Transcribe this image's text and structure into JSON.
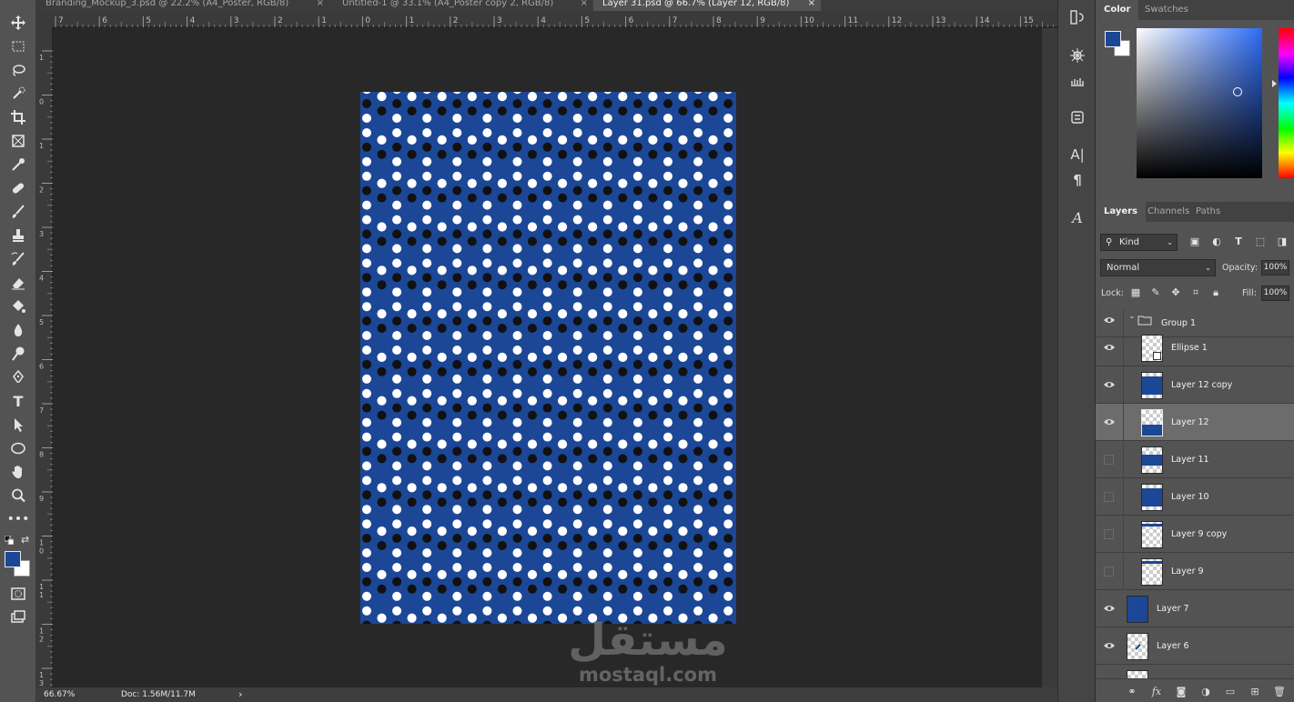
{
  "tabs": [
    {
      "label": "Branding_Mockup_3.psd @ 22.2% (A4_Poster, RGB/8)",
      "close": "×"
    },
    {
      "label": "Untitled-1 @ 33.1% (A4_Poster copy 2, RGB/8)",
      "close": "×"
    },
    {
      "label": "Layer 31.psd @ 66.7% (Layer 12, RGB/8)",
      "close": "×"
    }
  ],
  "tools": [
    "move-tool-icon",
    "marquee-tool-icon",
    "lasso-tool-icon",
    "quick-selection-tool-icon",
    "crop-tool-icon",
    "frame-tool-icon",
    "eyedropper-tool-icon",
    "healing-brush-tool-icon",
    "brush-tool-icon",
    "clone-stamp-tool-icon",
    "history-brush-tool-icon",
    "eraser-tool-icon",
    "paint-bucket-tool-icon",
    "blur-tool-icon",
    "dodge-tool-icon",
    "pen-tool-icon",
    "type-tool-icon",
    "path-selection-tool-icon",
    "ellipse-tool-icon",
    "hand-tool-icon",
    "zoom-tool-icon",
    "more-tools-icon"
  ],
  "ruler": {
    "top_ticks": [
      "7",
      "6",
      "5",
      "4",
      "3",
      "2",
      "1",
      "0",
      "1",
      "2",
      "3",
      "4",
      "5",
      "6",
      "7",
      "8",
      "9",
      "10",
      "11",
      "12",
      "13",
      "14",
      "15"
    ],
    "left_ticks": [
      "1",
      "0",
      "1",
      "2",
      "3",
      "4",
      "5",
      "6",
      "7",
      "8",
      "9",
      "1\n0",
      "1\n1",
      "1\n2",
      "1\n3"
    ]
  },
  "document": {
    "background": "#1c4796",
    "dot_white": "#ffffff",
    "dot_black": "#111111"
  },
  "status": {
    "zoom": "66.67%",
    "doc": "Doc: 1.56M/11.7M",
    "arrow": "›"
  },
  "watermark": {
    "logo": "مستقل",
    "text": "mostaql.com"
  },
  "color_panel": {
    "tabs": [
      "Color",
      "Swatches"
    ],
    "foreground": "#1c4796",
    "background": "#ffffff"
  },
  "layers_panel": {
    "tabs": [
      "Layers",
      "Channels",
      "Paths"
    ],
    "filter_kind": "Kind",
    "blend_mode": "Normal",
    "opacity_label": "Opacity:",
    "opacity_value": "100%",
    "lock_label": "Lock:",
    "fill_label": "Fill:",
    "fill_value": "100%",
    "layers": [
      {
        "name": "Group 1",
        "visible": true,
        "type": "group"
      },
      {
        "name": "Ellipse 1",
        "visible": true,
        "type": "shape"
      },
      {
        "name": "Layer 12 copy",
        "visible": true,
        "type": "pattern"
      },
      {
        "name": "Layer 12",
        "visible": true,
        "type": "pattern",
        "selected": true
      },
      {
        "name": "Layer 11",
        "visible": false,
        "type": "pattern"
      },
      {
        "name": "Layer 10",
        "visible": false,
        "type": "pattern"
      },
      {
        "name": "Layer 9 copy",
        "visible": false,
        "type": "transparent"
      },
      {
        "name": "Layer 9",
        "visible": false,
        "type": "transparent"
      },
      {
        "name": "Layer 7",
        "visible": true,
        "type": "solid"
      },
      {
        "name": "Layer 6",
        "visible": true,
        "type": "mark"
      }
    ],
    "footer_icons": [
      "link-layers-icon",
      "fx-icon",
      "add-mask-icon",
      "adjustment-layer-icon",
      "new-group-icon",
      "new-layer-icon",
      "delete-layer-icon"
    ]
  }
}
